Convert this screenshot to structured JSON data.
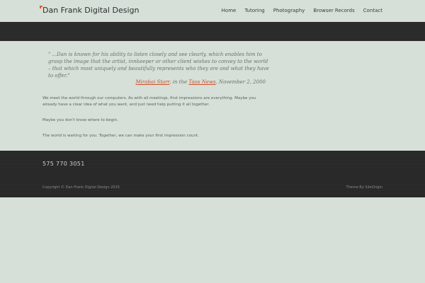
{
  "header": {
    "site_title": "Dan Frank Digital Design",
    "nav": [
      "Home",
      "Tutoring",
      "Photography",
      "Browser Records",
      "Contact"
    ]
  },
  "main": {
    "quote": "\" ...Dan is known for his ability to listen closely and see clearly, which enables him to grasp the image that the artist, innkeeper or other client wishes to convey to the world – that which most uniquely and beautifully represents who they are and what they have to offer.\"",
    "attribution": {
      "author": "Mirabai Starr",
      "middle": ", in the ",
      "source": "Taos News",
      "date": ", November 2, 2000"
    },
    "paragraphs": [
      "We meet the world through our computers. As with all meetings, first impressions are everything. Maybe you already have a clear idea of what you want, and just need help putting it all together.",
      "Maybe you don't know where to begin.",
      "The world is waiting for you. Together, we can make your first impression count."
    ]
  },
  "footer": {
    "phone": "575 770 3051",
    "copyright": "Copyright © Dan Frank Digital Design 2015",
    "theme_prefix": "Theme By ",
    "theme_link": "SiteOrigin"
  },
  "colors": {
    "background": "#d7e0d8",
    "dark_band": "#2a2a2a",
    "accent": "#c9502a"
  }
}
